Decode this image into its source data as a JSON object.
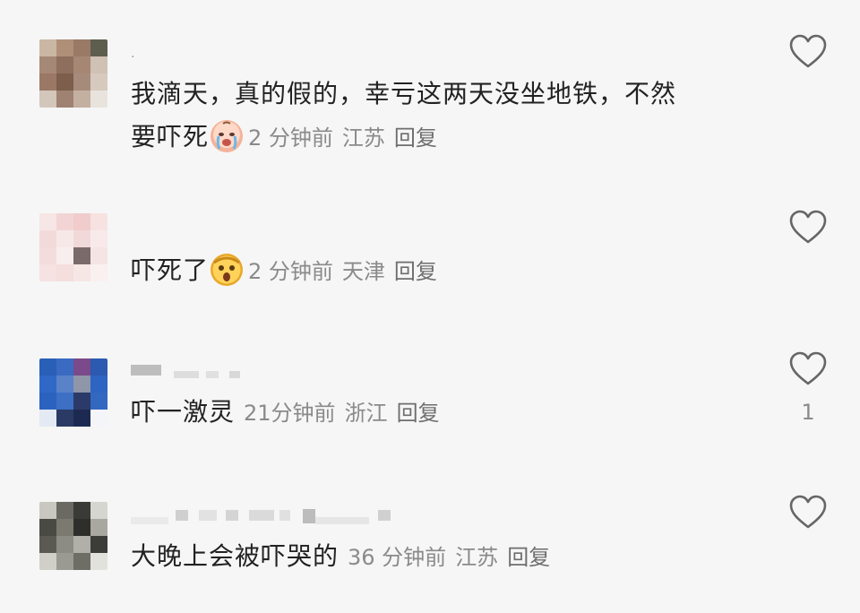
{
  "comments": [
    {
      "username": ".",
      "text_line1": "我滴天，真的假的，幸亏这两天没坐地铁，不然",
      "text_line2": "要吓死",
      "emoji": "crying-face-emoji",
      "time": "2 分钟前",
      "location": "江苏",
      "reply": "回复",
      "likes": ""
    },
    {
      "username": "",
      "text": "吓死了",
      "emoji": "shocked-face-emoji",
      "time": "2 分钟前",
      "location": "天津",
      "reply": "回复",
      "likes": ""
    },
    {
      "username": "",
      "text": "吓一激灵",
      "time": "21分钟前",
      "location": "浙江",
      "reply": "回复",
      "likes": "1"
    },
    {
      "username": "",
      "text": "大晚上会被吓哭的",
      "time": "36 分钟前",
      "location": "江苏",
      "reply": "回复",
      "likes": ""
    }
  ],
  "colors": {
    "background": "#f6f6f6",
    "text": "#222222",
    "meta": "#8a8a8a",
    "icon_stroke": "#666666"
  },
  "icons": {
    "like": "heart-outline-icon"
  }
}
